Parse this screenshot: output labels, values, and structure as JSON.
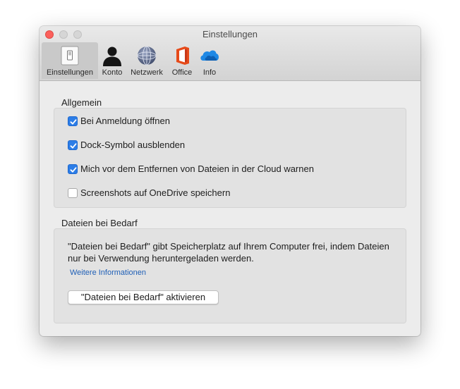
{
  "window": {
    "title": "Einstellungen"
  },
  "tabs": [
    {
      "label": "Einstellungen",
      "icon": "switch-icon",
      "selected": true
    },
    {
      "label": "Konto",
      "icon": "person-icon"
    },
    {
      "label": "Netzwerk",
      "icon": "globe-icon"
    },
    {
      "label": "Office",
      "icon": "office-icon",
      "color": "#e64a19"
    },
    {
      "label": "Info",
      "icon": "cloud-icon",
      "color": "#1e88e5"
    }
  ],
  "general": {
    "title": "Allgemein",
    "options": [
      {
        "label": "Bei Anmeldung öffnen",
        "checked": true
      },
      {
        "label": "Dock-Symbol ausblenden",
        "checked": true
      },
      {
        "label": "Mich vor dem Entfernen von Dateien in der Cloud warnen",
        "checked": true
      },
      {
        "label": "Screenshots auf OneDrive speichern",
        "checked": false
      }
    ]
  },
  "on_demand": {
    "title": "Dateien bei Bedarf",
    "description": "\"Dateien bei Bedarf\" gibt Speicherplatz auf Ihrem Computer frei, indem Dateien nur bei Verwendung heruntergeladen werden.",
    "link": "Weitere Informationen",
    "button": "\"Dateien bei Bedarf\" aktivieren"
  },
  "colors": {
    "accent": "#2c7de7",
    "link": "#1f5fb6",
    "close": "#fc605c"
  }
}
